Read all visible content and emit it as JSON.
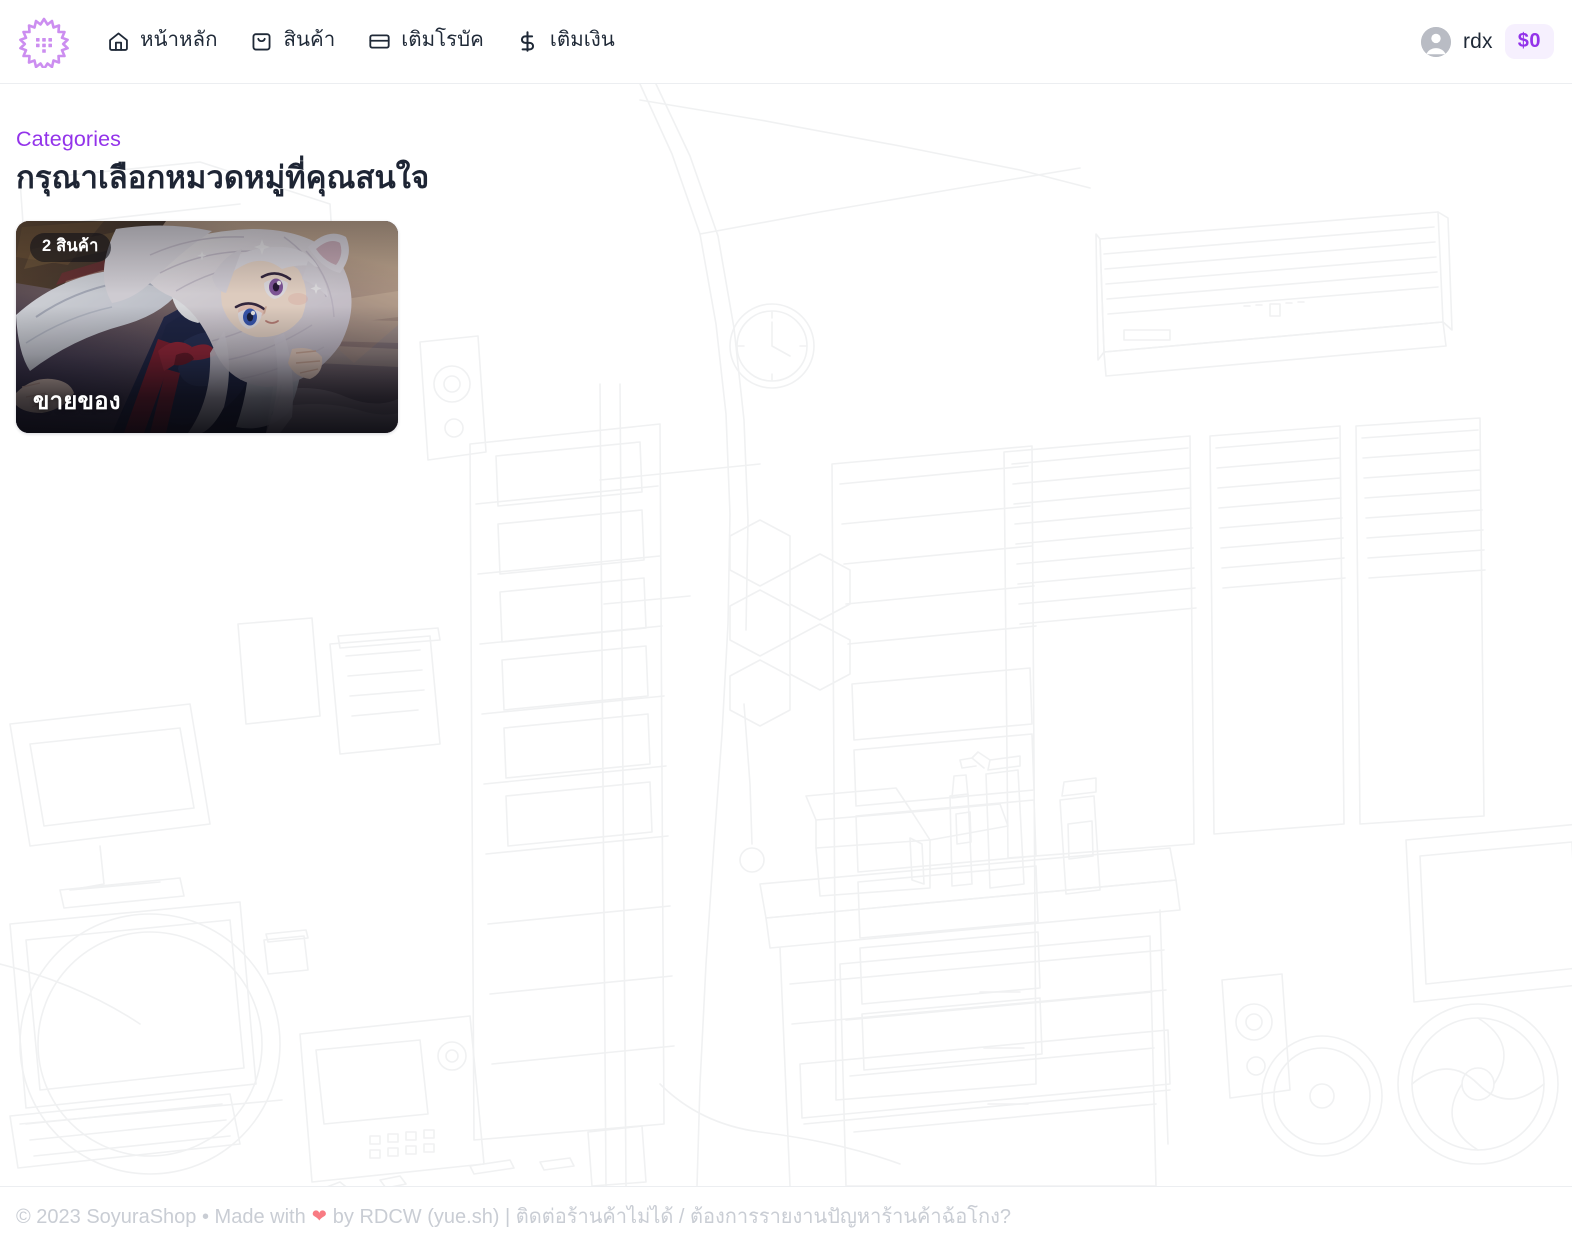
{
  "header": {
    "logo_icon": "sakura-flower-logo",
    "nav": [
      {
        "icon": "home-icon",
        "label": "หน้าหลัก"
      },
      {
        "icon": "shopping-bag-icon",
        "label": "สินค้า"
      },
      {
        "icon": "credit-card-icon",
        "label": "เติมโรบัค"
      },
      {
        "icon": "dollar-sign-icon",
        "label": "เติมเงิน"
      }
    ],
    "user": {
      "avatar_icon": "user-avatar-icon",
      "name": "rdx",
      "balance": "$0"
    }
  },
  "main": {
    "eyebrow": "Categories",
    "heading": "กรุณาเลือกหมวดหมู่ที่คุณสนใจ",
    "categories": [
      {
        "title": "ขายของ",
        "count_label": "2 สินค้า",
        "image_alt": "anime-character-artwork"
      }
    ]
  },
  "footer": {
    "copyright": "© 2023 SoyuraShop • Made with",
    "heart_icon": "heart-icon",
    "credit": "by RDCW (yue.sh) |",
    "report_link": "ติดต่อร้านค้าไม่ได้ / ต้องการรายงานปัญหาร้านค้าฉ้อโกง?"
  },
  "colors": {
    "accent_purple": "#9333ea",
    "badge_bg": "#f6f0fe",
    "heading": "#1e2534",
    "footer_text": "#c9cdd4",
    "heart": "#f87b83"
  }
}
